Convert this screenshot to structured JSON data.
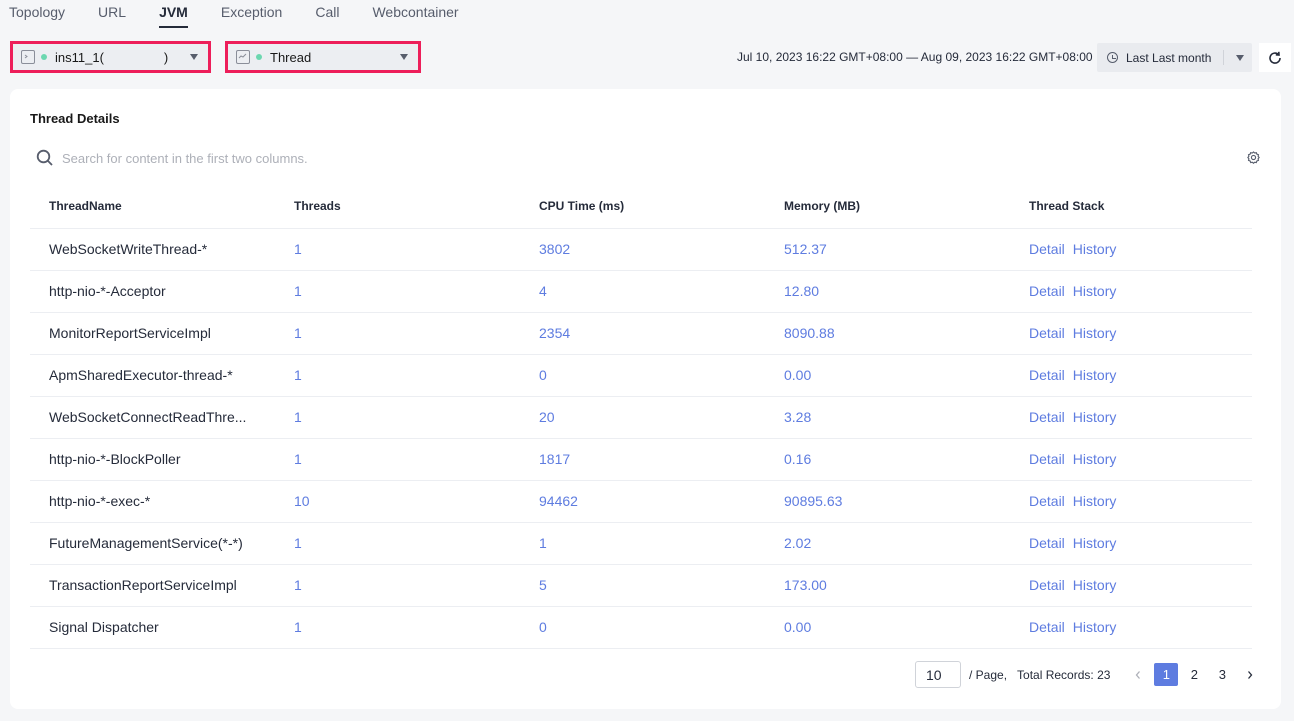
{
  "tabs": [
    {
      "label": "Topology",
      "active": false
    },
    {
      "label": "URL",
      "active": false
    },
    {
      "label": "JVM",
      "active": true
    },
    {
      "label": "Exception",
      "active": false
    },
    {
      "label": "Call",
      "active": false
    },
    {
      "label": "Webcontainer",
      "active": false
    }
  ],
  "instance_select": {
    "icon": "terminal-icon",
    "status_color": "#6cd7b0",
    "value": "ins11_1(",
    "value_suffix": ")"
  },
  "metric_select": {
    "icon": "monitor-chart-icon",
    "status_color": "#6cd7b0",
    "value": "Thread"
  },
  "time": {
    "range": "Jul 10, 2023 16:22 GMT+08:00 — Aug 09, 2023 16:22 GMT+08:00",
    "period": "Last Last month"
  },
  "card": {
    "title": "Thread Details",
    "search_placeholder": "Search for content in the first two columns."
  },
  "table": {
    "columns": [
      "ThreadName",
      "Threads",
      "CPU Time (ms)",
      "Memory (MB)",
      "Thread Stack"
    ],
    "action_detail": "Detail",
    "action_history": "History",
    "rows": [
      {
        "name": "WebSocketWriteThread-*",
        "threads": "1",
        "cpu": "3802",
        "memory": "512.37"
      },
      {
        "name": "http-nio-*-Acceptor",
        "threads": "1",
        "cpu": "4",
        "memory": "12.80"
      },
      {
        "name": "MonitorReportServiceImpl",
        "threads": "1",
        "cpu": "2354",
        "memory": "8090.88"
      },
      {
        "name": "ApmSharedExecutor-thread-*",
        "threads": "1",
        "cpu": "0",
        "memory": "0.00"
      },
      {
        "name": "WebSocketConnectReadThre...",
        "threads": "1",
        "cpu": "20",
        "memory": "3.28"
      },
      {
        "name": "http-nio-*-BlockPoller",
        "threads": "1",
        "cpu": "1817",
        "memory": "0.16"
      },
      {
        "name": "http-nio-*-exec-*",
        "threads": "10",
        "cpu": "94462",
        "memory": "90895.63"
      },
      {
        "name": "FutureManagementService(*-*)",
        "threads": "1",
        "cpu": "1",
        "memory": "2.02"
      },
      {
        "name": "TransactionReportServiceImpl",
        "threads": "1",
        "cpu": "5",
        "memory": "173.00"
      },
      {
        "name": "Signal Dispatcher",
        "threads": "1",
        "cpu": "0",
        "memory": "0.00"
      }
    ]
  },
  "pagination": {
    "page_size": "10",
    "per_page_label": "/ Page,",
    "total_label": "Total Records: 23",
    "pages": [
      "1",
      "2",
      "3"
    ],
    "current_page": "1"
  }
}
